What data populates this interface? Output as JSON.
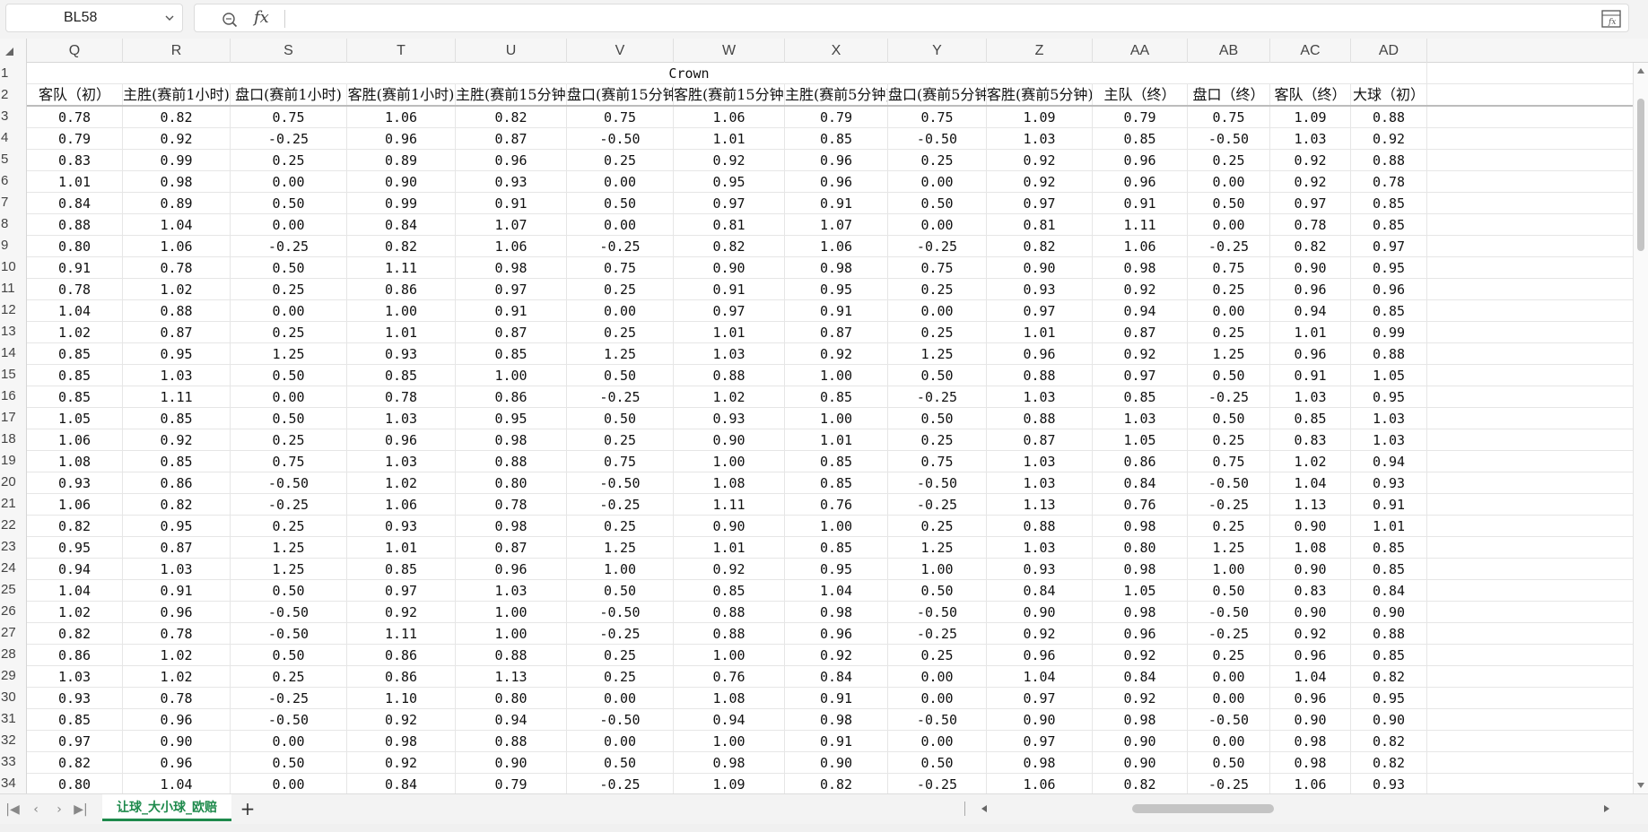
{
  "formula_bar": {
    "cell_ref": "BL58",
    "fx_label": "fx",
    "formula": ""
  },
  "columns": [
    "Q",
    "R",
    "S",
    "T",
    "U",
    "V",
    "W",
    "X",
    "Y",
    "Z",
    "AA",
    "AB",
    "AC",
    "AD"
  ],
  "row_numbers": [
    "1",
    "2",
    "3",
    "4",
    "5",
    "6",
    "7",
    "8",
    "9",
    "10",
    "11",
    "12",
    "13",
    "14",
    "15",
    "16",
    "17",
    "18",
    "19",
    "20",
    "21",
    "22",
    "23",
    "24",
    "25",
    "26",
    "27",
    "28",
    "29",
    "30",
    "31",
    "32",
    "33",
    "34"
  ],
  "merged_title": "Crown",
  "headers": [
    "客队（初）",
    "主胜(赛前1小时)",
    "盘口(赛前1小时)",
    "客胜(赛前1小时)",
    "主胜(赛前15分钟)",
    "盘口(赛前15分钟)",
    "客胜(赛前15分钟)",
    "主胜(赛前5分钟)",
    "盘口(赛前5分钟)",
    "客胜(赛前5分钟)",
    "主队（终）",
    "盘口（终）",
    "客队（终）",
    "大球（初）"
  ],
  "rows": [
    [
      "0.78",
      "0.82",
      "0.75",
      "1.06",
      "0.82",
      "0.75",
      "1.06",
      "0.79",
      "0.75",
      "1.09",
      "0.79",
      "0.75",
      "1.09",
      "0.88"
    ],
    [
      "0.79",
      "0.92",
      "-0.25",
      "0.96",
      "0.87",
      "-0.50",
      "1.01",
      "0.85",
      "-0.50",
      "1.03",
      "0.85",
      "-0.50",
      "1.03",
      "0.92"
    ],
    [
      "0.83",
      "0.99",
      "0.25",
      "0.89",
      "0.96",
      "0.25",
      "0.92",
      "0.96",
      "0.25",
      "0.92",
      "0.96",
      "0.25",
      "0.92",
      "0.88"
    ],
    [
      "1.01",
      "0.98",
      "0.00",
      "0.90",
      "0.93",
      "0.00",
      "0.95",
      "0.96",
      "0.00",
      "0.92",
      "0.96",
      "0.00",
      "0.92",
      "0.78"
    ],
    [
      "0.84",
      "0.89",
      "0.50",
      "0.99",
      "0.91",
      "0.50",
      "0.97",
      "0.91",
      "0.50",
      "0.97",
      "0.91",
      "0.50",
      "0.97",
      "0.85"
    ],
    [
      "0.88",
      "1.04",
      "0.00",
      "0.84",
      "1.07",
      "0.00",
      "0.81",
      "1.07",
      "0.00",
      "0.81",
      "1.11",
      "0.00",
      "0.78",
      "0.85"
    ],
    [
      "0.80",
      "1.06",
      "-0.25",
      "0.82",
      "1.06",
      "-0.25",
      "0.82",
      "1.06",
      "-0.25",
      "0.82",
      "1.06",
      "-0.25",
      "0.82",
      "0.97"
    ],
    [
      "0.91",
      "0.78",
      "0.50",
      "1.11",
      "0.98",
      "0.75",
      "0.90",
      "0.98",
      "0.75",
      "0.90",
      "0.98",
      "0.75",
      "0.90",
      "0.95"
    ],
    [
      "0.78",
      "1.02",
      "0.25",
      "0.86",
      "0.97",
      "0.25",
      "0.91",
      "0.95",
      "0.25",
      "0.93",
      "0.92",
      "0.25",
      "0.96",
      "0.96"
    ],
    [
      "1.04",
      "0.88",
      "0.00",
      "1.00",
      "0.91",
      "0.00",
      "0.97",
      "0.91",
      "0.00",
      "0.97",
      "0.94",
      "0.00",
      "0.94",
      "0.85"
    ],
    [
      "1.02",
      "0.87",
      "0.25",
      "1.01",
      "0.87",
      "0.25",
      "1.01",
      "0.87",
      "0.25",
      "1.01",
      "0.87",
      "0.25",
      "1.01",
      "0.99"
    ],
    [
      "0.85",
      "0.95",
      "1.25",
      "0.93",
      "0.85",
      "1.25",
      "1.03",
      "0.92",
      "1.25",
      "0.96",
      "0.92",
      "1.25",
      "0.96",
      "0.88"
    ],
    [
      "0.85",
      "1.03",
      "0.50",
      "0.85",
      "1.00",
      "0.50",
      "0.88",
      "1.00",
      "0.50",
      "0.88",
      "0.97",
      "0.50",
      "0.91",
      "1.05"
    ],
    [
      "0.85",
      "1.11",
      "0.00",
      "0.78",
      "0.86",
      "-0.25",
      "1.02",
      "0.85",
      "-0.25",
      "1.03",
      "0.85",
      "-0.25",
      "1.03",
      "0.95"
    ],
    [
      "1.05",
      "0.85",
      "0.50",
      "1.03",
      "0.95",
      "0.50",
      "0.93",
      "1.00",
      "0.50",
      "0.88",
      "1.03",
      "0.50",
      "0.85",
      "1.03"
    ],
    [
      "1.06",
      "0.92",
      "0.25",
      "0.96",
      "0.98",
      "0.25",
      "0.90",
      "1.01",
      "0.25",
      "0.87",
      "1.05",
      "0.25",
      "0.83",
      "1.03"
    ],
    [
      "1.08",
      "0.85",
      "0.75",
      "1.03",
      "0.88",
      "0.75",
      "1.00",
      "0.85",
      "0.75",
      "1.03",
      "0.86",
      "0.75",
      "1.02",
      "0.94"
    ],
    [
      "0.93",
      "0.86",
      "-0.50",
      "1.02",
      "0.80",
      "-0.50",
      "1.08",
      "0.85",
      "-0.50",
      "1.03",
      "0.84",
      "-0.50",
      "1.04",
      "0.93"
    ],
    [
      "1.06",
      "0.82",
      "-0.25",
      "1.06",
      "0.78",
      "-0.25",
      "1.11",
      "0.76",
      "-0.25",
      "1.13",
      "0.76",
      "-0.25",
      "1.13",
      "0.91"
    ],
    [
      "0.82",
      "0.95",
      "0.25",
      "0.93",
      "0.98",
      "0.25",
      "0.90",
      "1.00",
      "0.25",
      "0.88",
      "0.98",
      "0.25",
      "0.90",
      "1.01"
    ],
    [
      "0.95",
      "0.87",
      "1.25",
      "1.01",
      "0.87",
      "1.25",
      "1.01",
      "0.85",
      "1.25",
      "1.03",
      "0.80",
      "1.25",
      "1.08",
      "0.85"
    ],
    [
      "0.94",
      "1.03",
      "1.25",
      "0.85",
      "0.96",
      "1.00",
      "0.92",
      "0.95",
      "1.00",
      "0.93",
      "0.98",
      "1.00",
      "0.90",
      "0.85"
    ],
    [
      "1.04",
      "0.91",
      "0.50",
      "0.97",
      "1.03",
      "0.50",
      "0.85",
      "1.04",
      "0.50",
      "0.84",
      "1.05",
      "0.50",
      "0.83",
      "0.84"
    ],
    [
      "1.02",
      "0.96",
      "-0.50",
      "0.92",
      "1.00",
      "-0.50",
      "0.88",
      "0.98",
      "-0.50",
      "0.90",
      "0.98",
      "-0.50",
      "0.90",
      "0.90"
    ],
    [
      "0.82",
      "0.78",
      "-0.50",
      "1.11",
      "1.00",
      "-0.25",
      "0.88",
      "0.96",
      "-0.25",
      "0.92",
      "0.96",
      "-0.25",
      "0.92",
      "0.88"
    ],
    [
      "0.86",
      "1.02",
      "0.50",
      "0.86",
      "0.88",
      "0.25",
      "1.00",
      "0.92",
      "0.25",
      "0.96",
      "0.92",
      "0.25",
      "0.96",
      "0.85"
    ],
    [
      "1.03",
      "1.02",
      "0.25",
      "0.86",
      "1.13",
      "0.25",
      "0.76",
      "0.84",
      "0.00",
      "1.04",
      "0.84",
      "0.00",
      "1.04",
      "0.82"
    ],
    [
      "0.93",
      "0.78",
      "-0.25",
      "1.10",
      "0.80",
      "0.00",
      "1.08",
      "0.91",
      "0.00",
      "0.97",
      "0.92",
      "0.00",
      "0.96",
      "0.95"
    ],
    [
      "0.85",
      "0.96",
      "-0.50",
      "0.92",
      "0.94",
      "-0.50",
      "0.94",
      "0.98",
      "-0.50",
      "0.90",
      "0.98",
      "-0.50",
      "0.90",
      "0.90"
    ],
    [
      "0.97",
      "0.90",
      "0.00",
      "0.98",
      "0.88",
      "0.00",
      "1.00",
      "0.91",
      "0.00",
      "0.97",
      "0.90",
      "0.00",
      "0.98",
      "0.82"
    ],
    [
      "0.82",
      "0.96",
      "0.50",
      "0.92",
      "0.90",
      "0.50",
      "0.98",
      "0.90",
      "0.50",
      "0.98",
      "0.90",
      "0.50",
      "0.98",
      "0.82"
    ],
    [
      "0.80",
      "1.04",
      "0.00",
      "0.84",
      "0.79",
      "-0.25",
      "1.09",
      "0.82",
      "-0.25",
      "1.06",
      "0.82",
      "-0.25",
      "1.06",
      "0.93"
    ]
  ],
  "sheet_tabs": [
    "让球_大小球_欧赔"
  ],
  "add_sheet_label": "+",
  "nav_labels": {
    "first": "|◀",
    "prev": "‹",
    "next": "›",
    "last": "▶|"
  }
}
